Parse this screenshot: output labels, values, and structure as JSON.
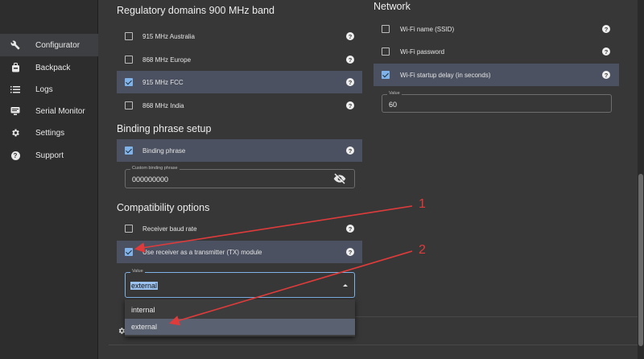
{
  "sidebar": {
    "items": [
      {
        "label": "Configurator",
        "icon": "wrench-icon"
      },
      {
        "label": "Backpack",
        "icon": "backpack-icon"
      },
      {
        "label": "Logs",
        "icon": "list-icon"
      },
      {
        "label": "Serial Monitor",
        "icon": "monitor-icon"
      },
      {
        "label": "Settings",
        "icon": "gear-icon"
      },
      {
        "label": "Support",
        "icon": "help-circle-icon"
      }
    ]
  },
  "regulatory": {
    "title": "Regulatory domains 900 MHz band",
    "items": [
      {
        "label": "915 MHz Australia",
        "checked": false
      },
      {
        "label": "868 MHz Europe",
        "checked": false
      },
      {
        "label": "915 MHz FCC",
        "checked": true
      },
      {
        "label": "868 MHz India",
        "checked": false
      }
    ]
  },
  "binding": {
    "title": "Binding phrase setup",
    "checkbox_label": "Binding phrase",
    "checked": true,
    "field_legend": "Custom binding phrase",
    "field_value": "000000000"
  },
  "compat": {
    "title": "Compatibility options",
    "items": [
      {
        "label": "Receiver baud rate",
        "checked": false
      },
      {
        "label": "Use receiver as a transmitter (TX) module",
        "checked": true
      }
    ],
    "select_legend": "Value",
    "select_value": "external",
    "options": [
      "internal",
      "external"
    ]
  },
  "network": {
    "title": "Network",
    "items": [
      {
        "label": "Wi-Fi name (SSID)",
        "checked": false
      },
      {
        "label": "Wi-Fi password",
        "checked": false
      },
      {
        "label": "Wi-Fi startup delay (in seconds)",
        "checked": true
      }
    ],
    "value_legend": "Value",
    "value": "60"
  },
  "help_glyph": "?",
  "annotations": [
    "1",
    "2"
  ],
  "colors": {
    "accent": "#7fb2e8",
    "highlight_row": "#4b5160",
    "annotation_red": "#e03b3b"
  }
}
